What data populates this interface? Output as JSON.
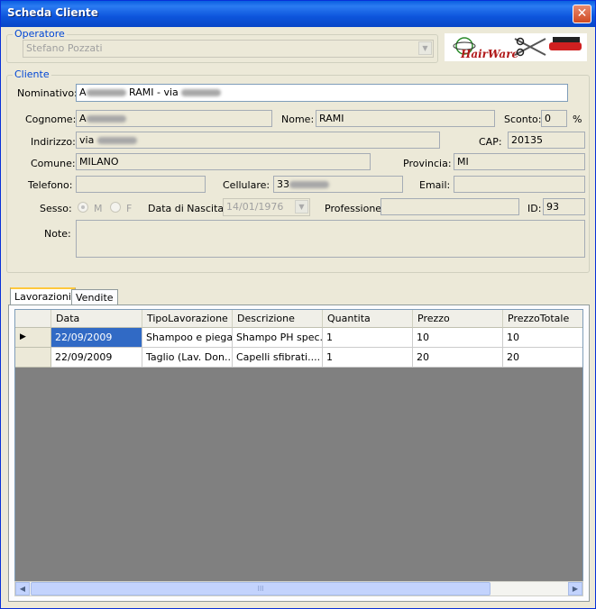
{
  "window": {
    "title": "Scheda Cliente"
  },
  "icons": {
    "close": "close-icon",
    "dropdown": "chevron-down-icon",
    "row_pointer": "current-row-icon",
    "scroll_left": "arrow-left-icon",
    "scroll_right": "arrow-right-icon"
  },
  "operatore": {
    "legend": "Operatore",
    "value": "Stefano Pozzati"
  },
  "logo": {
    "text": "HairWare"
  },
  "cliente": {
    "legend": "Cliente",
    "nominativo": {
      "label": "Nominativo:",
      "prefix": "A",
      "middle": "RAMI - via"
    },
    "cognome": {
      "label": "Cognome:",
      "value": "A"
    },
    "nome": {
      "label": "Nome:",
      "value": "RAMI"
    },
    "sconto": {
      "label": "Sconto:",
      "value": "0",
      "unit": "%"
    },
    "indirizzo": {
      "label": "Indirizzo:",
      "value": "via"
    },
    "cap": {
      "label": "CAP:",
      "value": "20135"
    },
    "comune": {
      "label": "Comune:",
      "value": "MILANO"
    },
    "provincia": {
      "label": "Provincia:",
      "value": "MI"
    },
    "telefono": {
      "label": "Telefono:",
      "value": ""
    },
    "cellulare": {
      "label": "Cellulare:",
      "value": "33"
    },
    "email": {
      "label": "Email:",
      "value": ""
    },
    "sesso": {
      "label": "Sesso:",
      "m": "M",
      "f": "F",
      "selected": "M"
    },
    "nascita": {
      "label": "Data di Nascita:",
      "value": "14/01/1976"
    },
    "professione": {
      "label": "Professione:",
      "value": ""
    },
    "id": {
      "label": "ID:",
      "value": "93"
    },
    "note": {
      "label": "Note:",
      "value": ""
    }
  },
  "tabs": [
    {
      "label": "Lavorazioni",
      "active": true
    },
    {
      "label": "Vendite",
      "active": false
    }
  ],
  "grid": {
    "columns": [
      "Data",
      "TipoLavorazione",
      "Descrizione",
      "Quantita",
      "Prezzo",
      "PrezzoTotale"
    ],
    "rows": [
      [
        "22/09/2009",
        "Shampoo e piega...",
        "Shampo PH spec...",
        "1",
        "10",
        "10"
      ],
      [
        "22/09/2009",
        "Taglio (Lav. Don...",
        "Capelli sfibrati....",
        "1",
        "20",
        "20"
      ]
    ]
  },
  "scrollbar": {
    "thumb_grip": "III"
  }
}
